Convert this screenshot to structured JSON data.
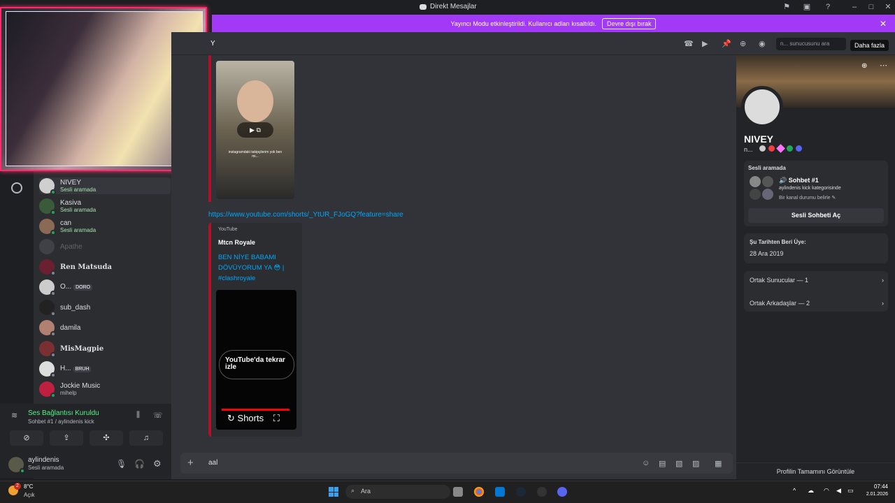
{
  "window": {
    "title": "Direkt Mesajlar"
  },
  "banner": {
    "text": "Yayıncı Modu etkinleştirildi. Kullanıcı adları kısaltıldı.",
    "button": "Devre dışı bırak"
  },
  "topbar": {
    "channel_letter": "Y",
    "search_placeholder": "n... sunucusunu ara",
    "more_label": "Daha fazla"
  },
  "members": [
    {
      "name": "NIVEY",
      "sub": "Sesli aramada",
      "selected": true
    },
    {
      "name": "Kasiva",
      "sub": "Sesli aramada"
    },
    {
      "name": "can",
      "sub": "Sesli aramada"
    },
    {
      "name": "Apathe",
      "sub": ""
    },
    {
      "name": "Ren Matsuda",
      "sub": ""
    },
    {
      "name": "O...",
      "tag": "DORO"
    },
    {
      "name": "sub_dash",
      "sub": ""
    },
    {
      "name": "damila",
      "sub": ""
    },
    {
      "name": "MisMagpie",
      "sub": ""
    },
    {
      "name": "H...",
      "tag": "BRUH"
    },
    {
      "name": "Jockie Music",
      "sub": "mihelp"
    }
  ],
  "voice": {
    "status": "Ses Bağlantısı Kuruldu",
    "channel": "Sohbet #1 / aylindenis kick"
  },
  "user": {
    "name": "aylindenis",
    "status": "Sesli aramada"
  },
  "messages": {
    "short_caption": "instagramdaki takipçilerim yok ben mi...",
    "link": "https://www.youtube.com/shorts/_YtUR_FJoGQ?feature=share",
    "embed": {
      "provider": "YouTube",
      "author": "Mtcn Royale",
      "title": "BEN NİYE BABAMI DÖVÜYORUM YA 😳 | #clashroyale",
      "watch_label": "YouTube'da tekrar izle",
      "shorts_label": "Shorts"
    }
  },
  "composer": {
    "text": "aal"
  },
  "profile": {
    "name": "NIVEY",
    "short": "n...",
    "voice_section": "Sesli aramada",
    "voice_channel": "Sohbet #1",
    "voice_category": "aylindenis kick kategorisinde",
    "voice_status_hint": "Bir kanal durumu belirle",
    "open_voice_button": "Sesli Sohbeti Aç",
    "member_since_title": "Şu Tarihten Beri Üye:",
    "member_since": "28 Ara 2019",
    "mutual_servers": "Ortak Sunucular — 1",
    "mutual_friends": "Ortak Arkadaşlar — 2",
    "view_full": "Profilin Tamamını Görüntüle"
  },
  "taskbar": {
    "weather_temp": "8°C",
    "weather_desc": "Açık",
    "notif_count": "2",
    "search_label": "Ara",
    "time": "07:44",
    "date": "2.01.2026"
  }
}
